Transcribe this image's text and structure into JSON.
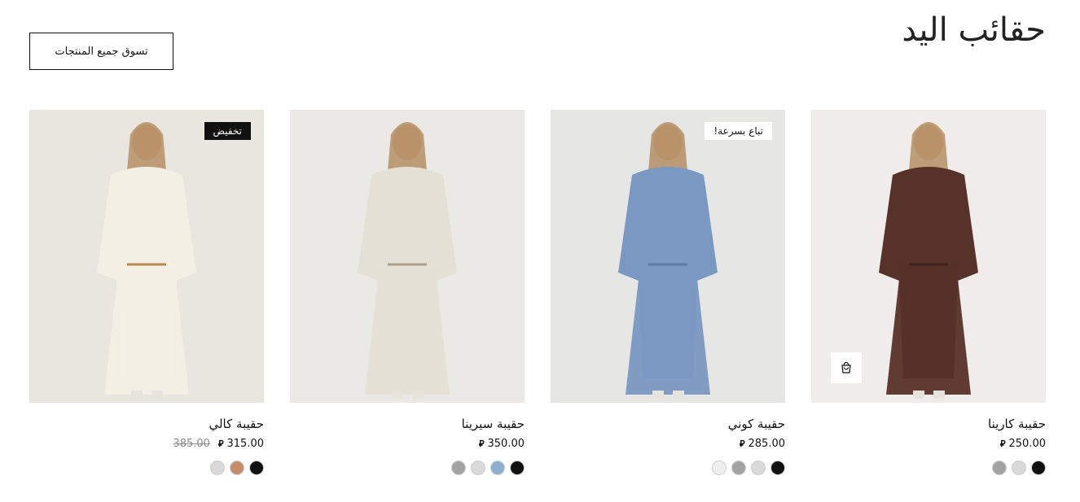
{
  "section": {
    "title": "حقائب اليد",
    "shop_all_label": "تسوق جميع المنتجات"
  },
  "currency_symbol": "⃁",
  "products": [
    {
      "name": "حقيبة كارينا",
      "price": "250.00",
      "old_price": "",
      "badge": "",
      "swatches": [
        "#111111",
        "#d9d9d9",
        "#a3a3a3"
      ],
      "show_cart": true,
      "palette": {
        "bg": "#efeceb",
        "garment": "#563228",
        "accent": "#3f241d"
      }
    },
    {
      "name": "حقيبة كوني",
      "price": "285.00",
      "old_price": "",
      "badge": "تباع بسرعة!",
      "swatches": [
        "#111111",
        "#d9d9d9",
        "#a3a3a3",
        "#eeeeee"
      ],
      "show_cart": false,
      "palette": {
        "bg": "#e6e6e4",
        "garment": "#7a98c1",
        "accent": "#5d7ba6"
      }
    },
    {
      "name": "حقيبة سيرينا",
      "price": "350.00",
      "old_price": "",
      "badge": "",
      "swatches": [
        "#111111",
        "#8fb0cc",
        "#d9d9d9",
        "#a3a3a3"
      ],
      "show_cart": false,
      "palette": {
        "bg": "#ebe9e6",
        "garment": "#e5e0d6",
        "accent": "#a99f90"
      }
    },
    {
      "name": "حقيبة كالي",
      "price": "315.00",
      "old_price": "385.00",
      "badge": "تخفيض",
      "swatches": [
        "#111111",
        "#c58e6b",
        "#d9d9d9"
      ],
      "show_cart": false,
      "palette": {
        "bg": "#e9e5df",
        "garment": "#f3efe5",
        "accent": "#b98a4d"
      }
    }
  ]
}
